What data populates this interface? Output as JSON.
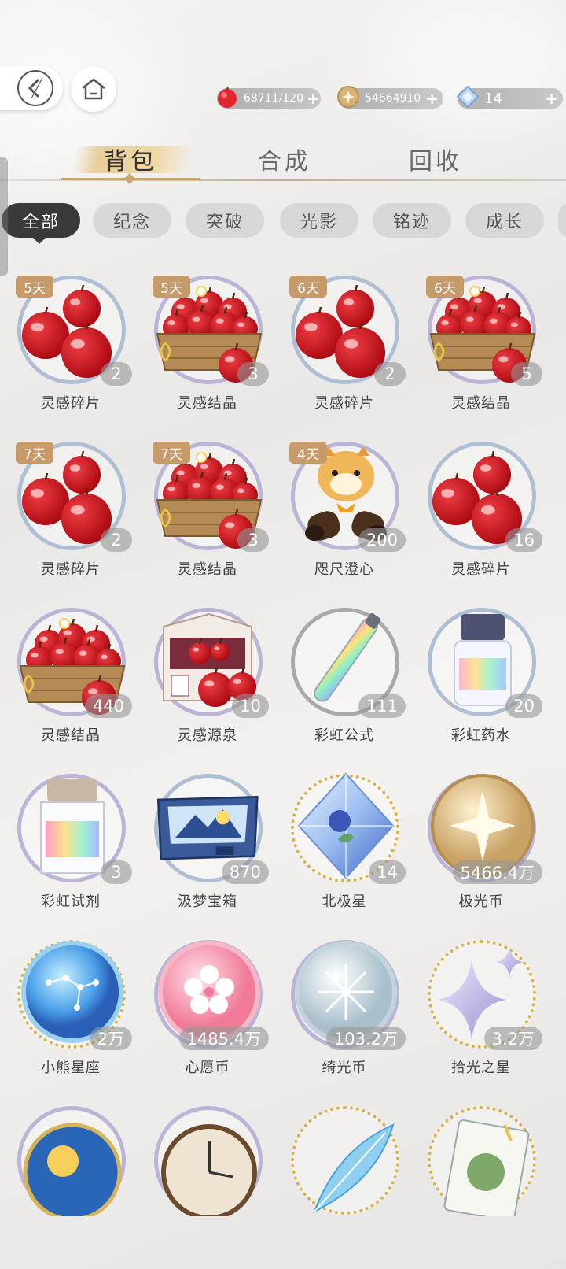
{
  "currencies": [
    {
      "icon": "apple-icon",
      "value": "68711/120"
    },
    {
      "icon": "aurora-coin-icon",
      "value": "54664910"
    },
    {
      "icon": "polaris-diamond-icon",
      "value": "14"
    }
  ],
  "tabs": [
    "背包",
    "合成",
    "回收"
  ],
  "active_tab": "背包",
  "filters": [
    "全部",
    "纪念",
    "突破",
    "光影",
    "铭迹",
    "成长"
  ],
  "active_filter": "全部",
  "items": [
    {
      "name": "灵感碎片",
      "count": "2",
      "days": "5天",
      "icon": "apple-pile-icon"
    },
    {
      "name": "灵感结晶",
      "count": "3",
      "days": "5天",
      "icon": "apple-basket-icon"
    },
    {
      "name": "灵感碎片",
      "count": "2",
      "days": "6天",
      "icon": "apple-pile-icon"
    },
    {
      "name": "灵感结晶",
      "count": "5",
      "days": "6天",
      "icon": "apple-basket-icon"
    },
    {
      "name": "灵感碎片",
      "count": "2",
      "days": "7天",
      "icon": "apple-pile-icon"
    },
    {
      "name": "灵感结晶",
      "count": "3",
      "days": "7天",
      "icon": "apple-basket-icon"
    },
    {
      "name": "咫尺澄心",
      "count": "200",
      "days": "4天",
      "icon": "tiger-binoculars-icon"
    },
    {
      "name": "灵感碎片",
      "count": "16",
      "days": "",
      "icon": "apple-pile-icon"
    },
    {
      "name": "灵感结晶",
      "count": "440",
      "days": "",
      "icon": "apple-basket-icon"
    },
    {
      "name": "灵感源泉",
      "count": "10",
      "days": "",
      "icon": "apple-box-icon"
    },
    {
      "name": "彩虹公式",
      "count": "111",
      "days": "",
      "icon": "rainbow-vial-icon"
    },
    {
      "name": "彩虹药水",
      "count": "20",
      "days": "",
      "icon": "rainbow-bottle-icon"
    },
    {
      "name": "彩虹试剂",
      "count": "3",
      "days": "",
      "icon": "rainbow-reagent-icon"
    },
    {
      "name": "汲梦宝箱",
      "count": "870",
      "days": "",
      "icon": "dream-chest-icon"
    },
    {
      "name": "北极星",
      "count": "14",
      "days": "",
      "icon": "polaris-crystal-icon"
    },
    {
      "name": "极光币",
      "count": "5466.4万",
      "days": "",
      "icon": "aurora-coin-icon"
    },
    {
      "name": "小熊星座",
      "count": "2万",
      "days": "",
      "icon": "ursa-coin-icon"
    },
    {
      "name": "心愿币",
      "count": "1485.4万",
      "days": "",
      "icon": "wish-coin-icon"
    },
    {
      "name": "绮光币",
      "count": "103.2万",
      "days": "",
      "icon": "silver-coin-icon"
    },
    {
      "name": "拾光之星",
      "count": "3.2万",
      "days": "",
      "icon": "sparkle-star-icon"
    },
    {
      "name": "",
      "count": "",
      "days": "",
      "icon": "sun-medallion-icon"
    },
    {
      "name": "",
      "count": "",
      "days": "",
      "icon": "clock-icon"
    },
    {
      "name": "",
      "count": "",
      "days": "",
      "icon": "feather-icon"
    },
    {
      "name": "",
      "count": "",
      "days": "",
      "icon": "herb-card-icon"
    }
  ]
}
